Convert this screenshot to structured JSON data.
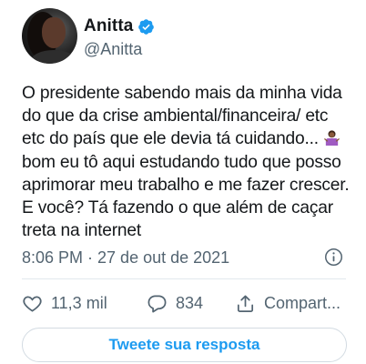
{
  "author": {
    "display_name": "Anitta",
    "handle": "@Anitta",
    "verified": true,
    "avatar_icon": "avatar-photo"
  },
  "tweet": {
    "text": "O presidente sabendo mais da minha vida\ndo que da crise ambiental/financeira/ etc\netc do país que ele devia tá cuidando...",
    "text_after_emoji": "\nbom eu tô aqui estudando tudo que posso\naprimorar meu trabalho e me fazer crescer.\nE você? Tá fazendo o que além de caçar\ntreta na internet",
    "emoji": "person-shrugging-emoji",
    "timestamp": "8:06 PM · 27 de out de 2021"
  },
  "actions": {
    "likes": "11,3 mil",
    "replies": "834",
    "share_label": "Compart..."
  },
  "reply_button_label": "Tweete sua resposta",
  "colors": {
    "accent": "#1d9bf0",
    "text": "#14171a",
    "secondary_text": "#536471",
    "divider": "#e1e8ed"
  }
}
